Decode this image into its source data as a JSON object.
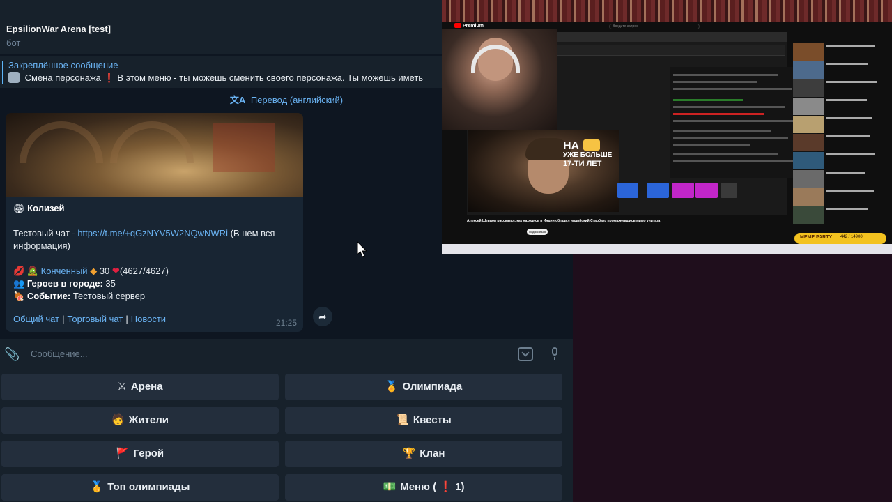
{
  "chat": {
    "title": "EpsilionWar Arena [test]",
    "subtitle": "бот"
  },
  "pinned": {
    "title": "Закреплённое сообщение",
    "text": "Смена персонажа ❗ В этом меню - ты можешь сменить своего персонажа. Ты можешь иметь"
  },
  "translate": {
    "label": "Перевод (английский)"
  },
  "message": {
    "heading": "Колизей",
    "test_chat_prefix": "Тестовый чат - ",
    "test_chat_link": "https://t.me/+qGzNYV5W2NQwNWRi",
    "test_chat_suffix": " (В нем вся",
    "test_chat_suffix2": "информация)",
    "char_name": "Конченный",
    "char_level": "30",
    "char_hp": "(4627/4627)",
    "heroes_label": "Героев в городе:",
    "heroes_value": "35",
    "event_label": "Событие:",
    "event_value": "Тестовый сервер",
    "links": [
      "Общий чат",
      "Торговый чат",
      "Новости"
    ],
    "time": "21:25"
  },
  "composer": {
    "placeholder": "Сообщение..."
  },
  "keyboard": {
    "buttons": [
      {
        "icon": "⚔",
        "label": "Арена"
      },
      {
        "icon": "🏅",
        "label": "Олимпиада"
      },
      {
        "icon": "🧑",
        "label": "Жители"
      },
      {
        "icon": "📜",
        "label": "Квесты"
      },
      {
        "icon": "🚩",
        "label": "Герой"
      },
      {
        "icon": "🏆",
        "label": "Клан"
      },
      {
        "icon": "🥇",
        "label": "Топ олимпиады"
      },
      {
        "icon": "💵",
        "label": "Меню ( ❗ 1)"
      }
    ]
  },
  "stream": {
    "yt_logo": "Premium",
    "search_placeholder": "Введите запрос",
    "overlay_line1": "НА",
    "overlay_line2": "УЖЕ БОЛЬШЕ",
    "overlay_line3": "17-ТИ ЛЕТ",
    "video_title": "Алексей Шевцов рассказал, как находясь в Индии обгадил индийский Старбакс промахнувшись мимо унитаза",
    "subscribe": "Подписаться",
    "meme_label": "MEME PARTY",
    "meme_count": "442 / 14900"
  },
  "colors": {
    "telegram_bg": "#0e1621",
    "telegram_panel": "#17212b",
    "bubble": "#182533",
    "accent_link": "#6ab3f3",
    "keyboard_button": "#232e3c"
  }
}
